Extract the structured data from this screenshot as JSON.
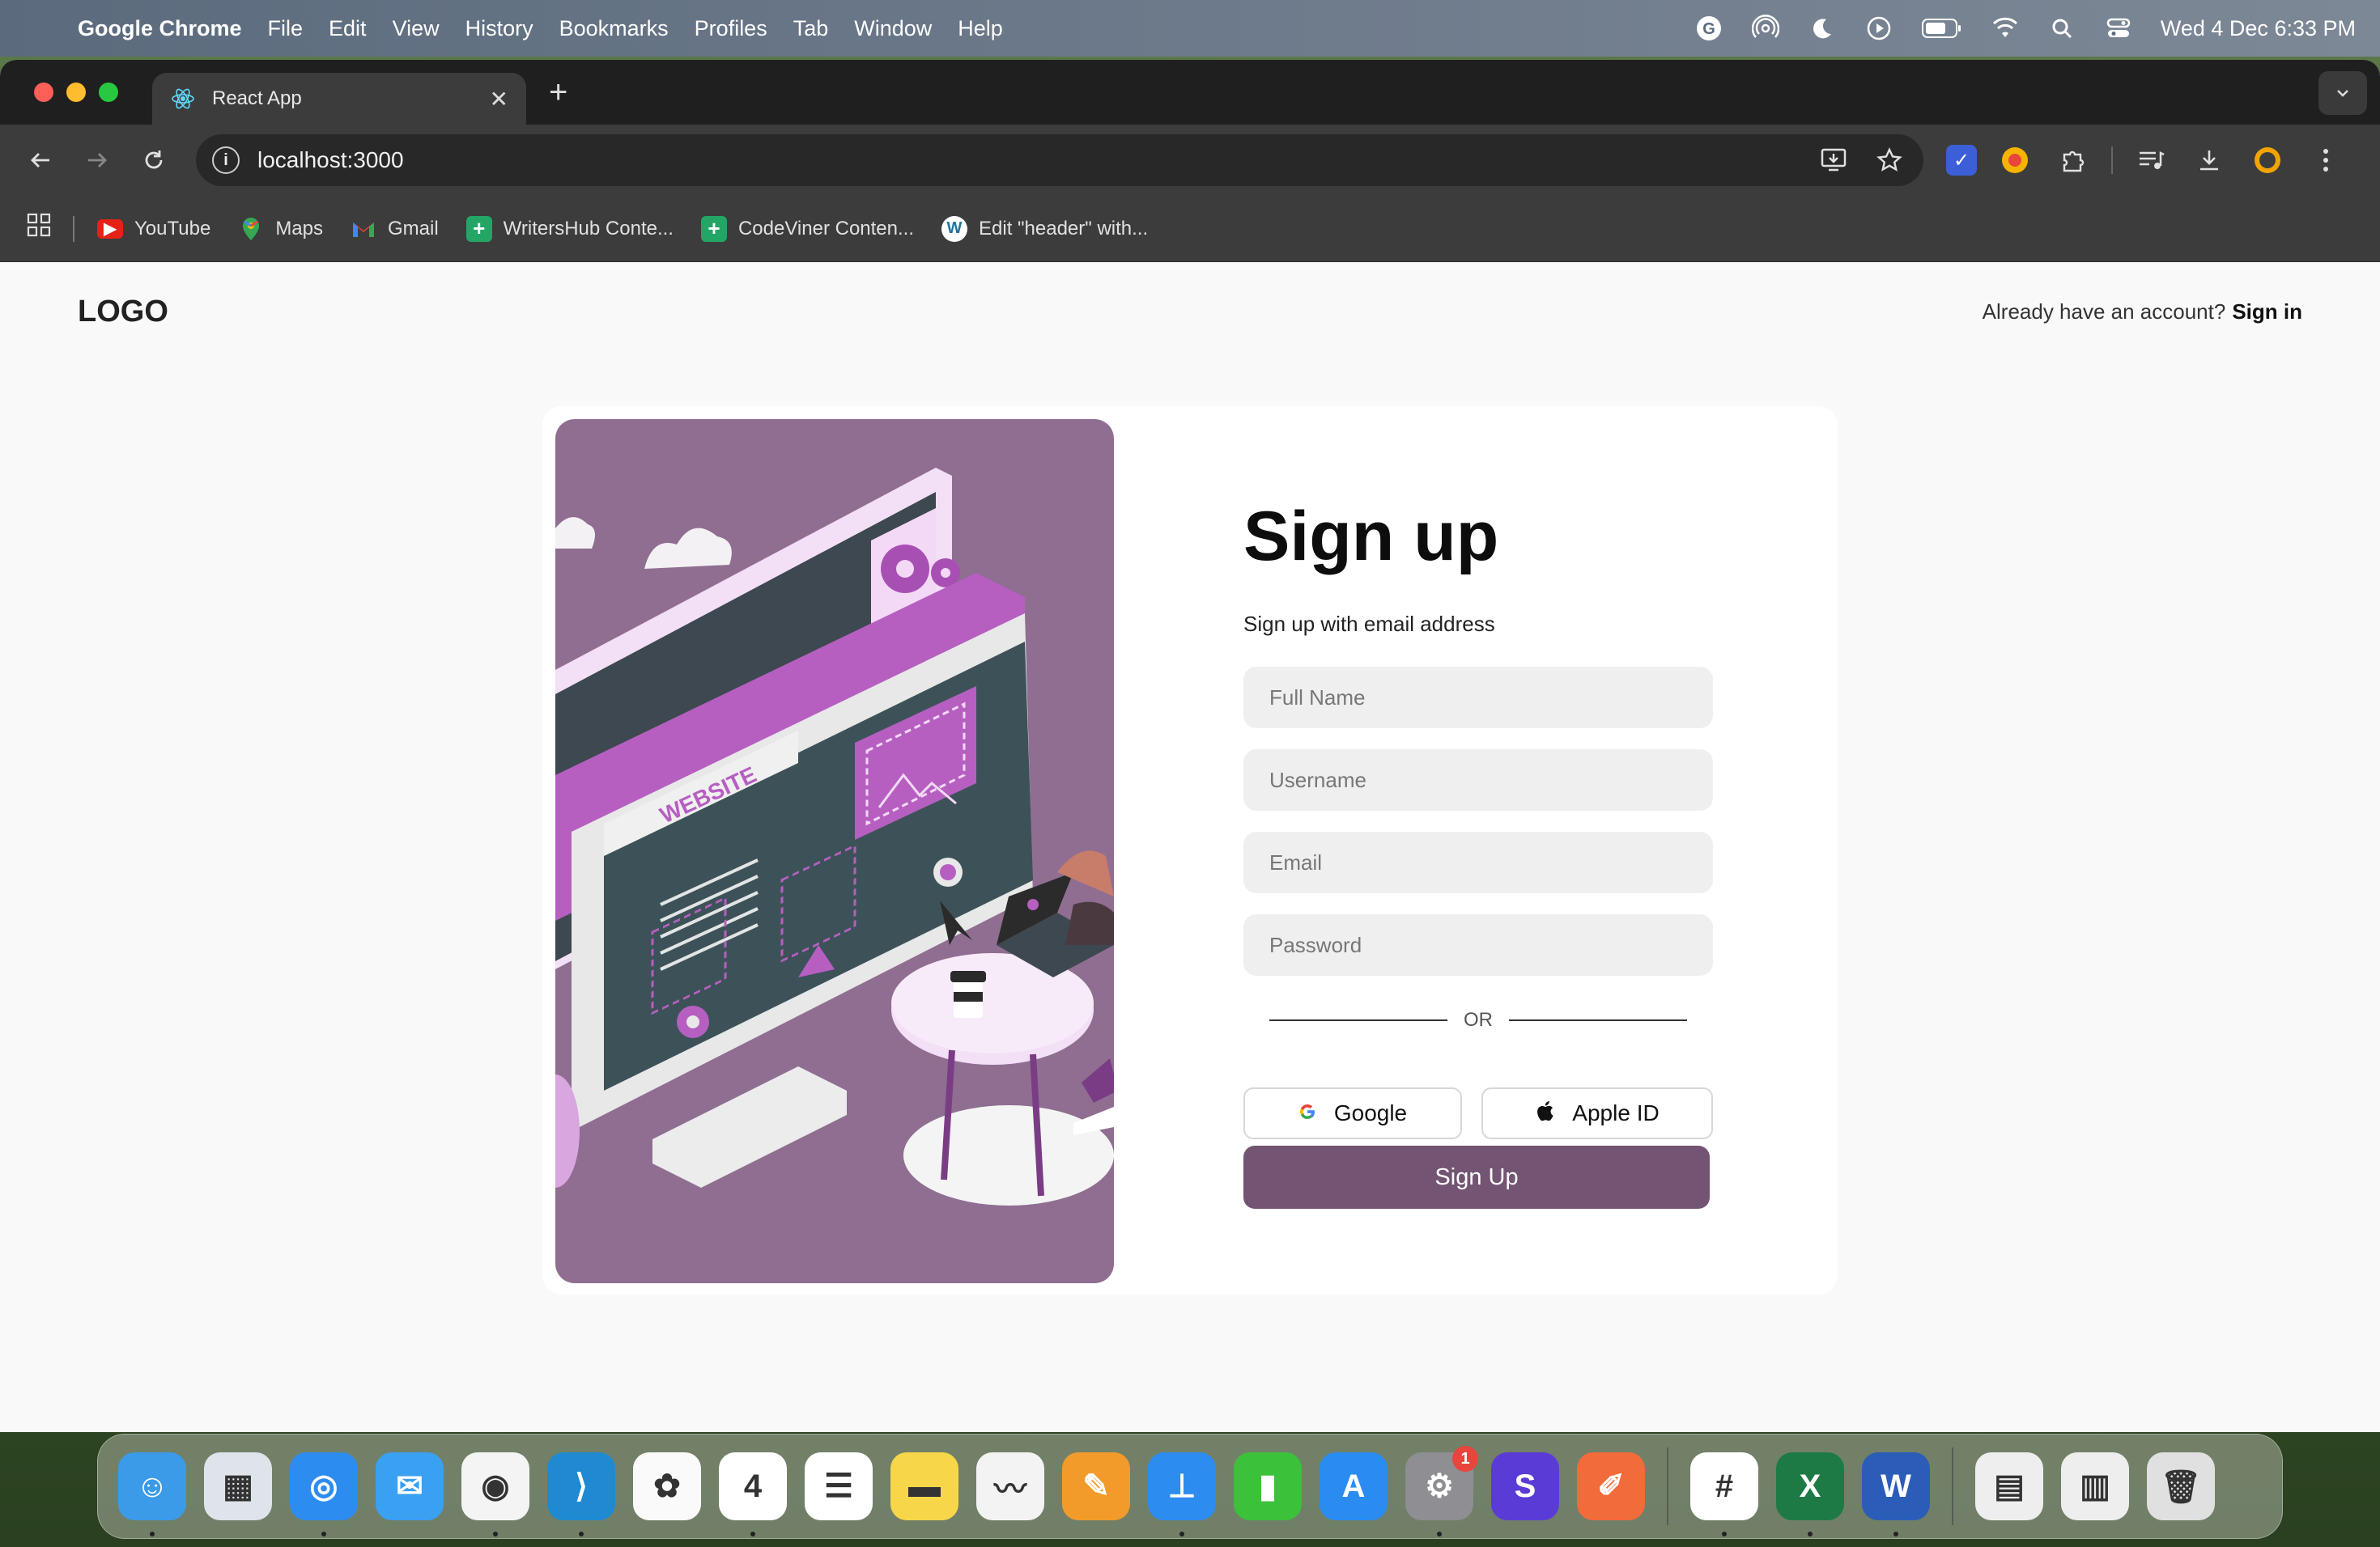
{
  "menubar": {
    "app_name": "Google Chrome",
    "items": [
      "File",
      "Edit",
      "View",
      "History",
      "Bookmarks",
      "Profiles",
      "Tab",
      "Window",
      "Help"
    ],
    "clock": "Wed 4 Dec  6:33 PM",
    "status_icons": [
      "grammarly-icon",
      "airdrop-icon",
      "focus-moon-icon",
      "play-icon",
      "battery-icon",
      "wifi-icon",
      "spotlight-search-icon",
      "control-center-icon"
    ]
  },
  "browser": {
    "tab_title": "React App",
    "url": "localhost:3000",
    "bookmarks": [
      {
        "label": "YouTube",
        "icon": "youtube-icon",
        "color": "#e62117"
      },
      {
        "label": "Maps",
        "icon": "maps-icon",
        "color": "#34a853"
      },
      {
        "label": "Gmail",
        "icon": "gmail-icon",
        "color": "#ea4335"
      },
      {
        "label": "WritersHub Conte...",
        "icon": "sheets-icon",
        "color": "#23a566"
      },
      {
        "label": "CodeViner Conten...",
        "icon": "sheets-icon",
        "color": "#23a566"
      },
      {
        "label": "Edit \"header\" with...",
        "icon": "wordpress-icon",
        "color": "#ffffff"
      }
    ]
  },
  "page": {
    "logo": "LOGO",
    "signin_prompt": "Already have an account?",
    "signin_link": "Sign in",
    "form": {
      "title": "Sign up",
      "subtitle": "Sign up with email address",
      "full_name_placeholder": "Full Name",
      "username_placeholder": "Username",
      "email_placeholder": "Email",
      "password_placeholder": "Password",
      "or": "OR",
      "google": "Google",
      "apple": "Apple ID",
      "submit": "Sign Up"
    },
    "illustration": {
      "website_label": "WEBSITE",
      "bg_color": "#8f6e91",
      "accent_color": "#b65fc1"
    }
  },
  "dock": {
    "apps": [
      {
        "name": "finder",
        "label": "☺",
        "color": "#3b9be8",
        "running": true
      },
      {
        "name": "launchpad",
        "label": "▦",
        "color": "#dfe3ea",
        "running": false
      },
      {
        "name": "safari",
        "label": "◎",
        "color": "#2d8cf0",
        "running": true
      },
      {
        "name": "mail",
        "label": "✉",
        "color": "#3aa0f2",
        "running": false
      },
      {
        "name": "chrome",
        "label": "◉",
        "color": "#f4f4f4",
        "running": true
      },
      {
        "name": "vscode",
        "label": "⟩",
        "color": "#1f8ad2",
        "running": true
      },
      {
        "name": "photos",
        "label": "✿",
        "color": "#fafafa",
        "running": false
      },
      {
        "name": "calendar",
        "label": "4",
        "color": "#ffffff",
        "running": true
      },
      {
        "name": "reminders",
        "label": "☰",
        "color": "#ffffff",
        "running": false
      },
      {
        "name": "notes",
        "label": "▬",
        "color": "#f7d64a",
        "running": false
      },
      {
        "name": "freeform",
        "label": "〰",
        "color": "#f3f3f3",
        "running": false
      },
      {
        "name": "pages",
        "label": "✎",
        "color": "#f29b2a",
        "running": false
      },
      {
        "name": "keynote",
        "label": "⊥",
        "color": "#2d8cf0",
        "running": true
      },
      {
        "name": "numbers",
        "label": "▮",
        "color": "#3cc13b",
        "running": false
      },
      {
        "name": "app-store",
        "label": "A",
        "color": "#2a8cf0",
        "running": false
      },
      {
        "name": "system-settings",
        "label": "⚙",
        "color": "#8e8e93",
        "running": true,
        "badge": "1"
      },
      {
        "name": "figma-like",
        "label": "S",
        "color": "#5b3bd6",
        "running": false
      },
      {
        "name": "postman",
        "label": "✐",
        "color": "#f26b3a",
        "running": false
      },
      {
        "name": "slack",
        "label": "#",
        "color": "#ffffff",
        "running": true
      },
      {
        "name": "excel",
        "label": "X",
        "color": "#1d7a45",
        "running": true
      },
      {
        "name": "word",
        "label": "W",
        "color": "#2b5db8",
        "running": true
      }
    ],
    "right_apps": [
      {
        "name": "document-stack",
        "label": "▤",
        "color": "#eeeeee"
      },
      {
        "name": "screenshot-stack",
        "label": "▥",
        "color": "#eeeeee"
      },
      {
        "name": "trash",
        "label": "🗑",
        "color": "#e0e0e0"
      }
    ]
  }
}
